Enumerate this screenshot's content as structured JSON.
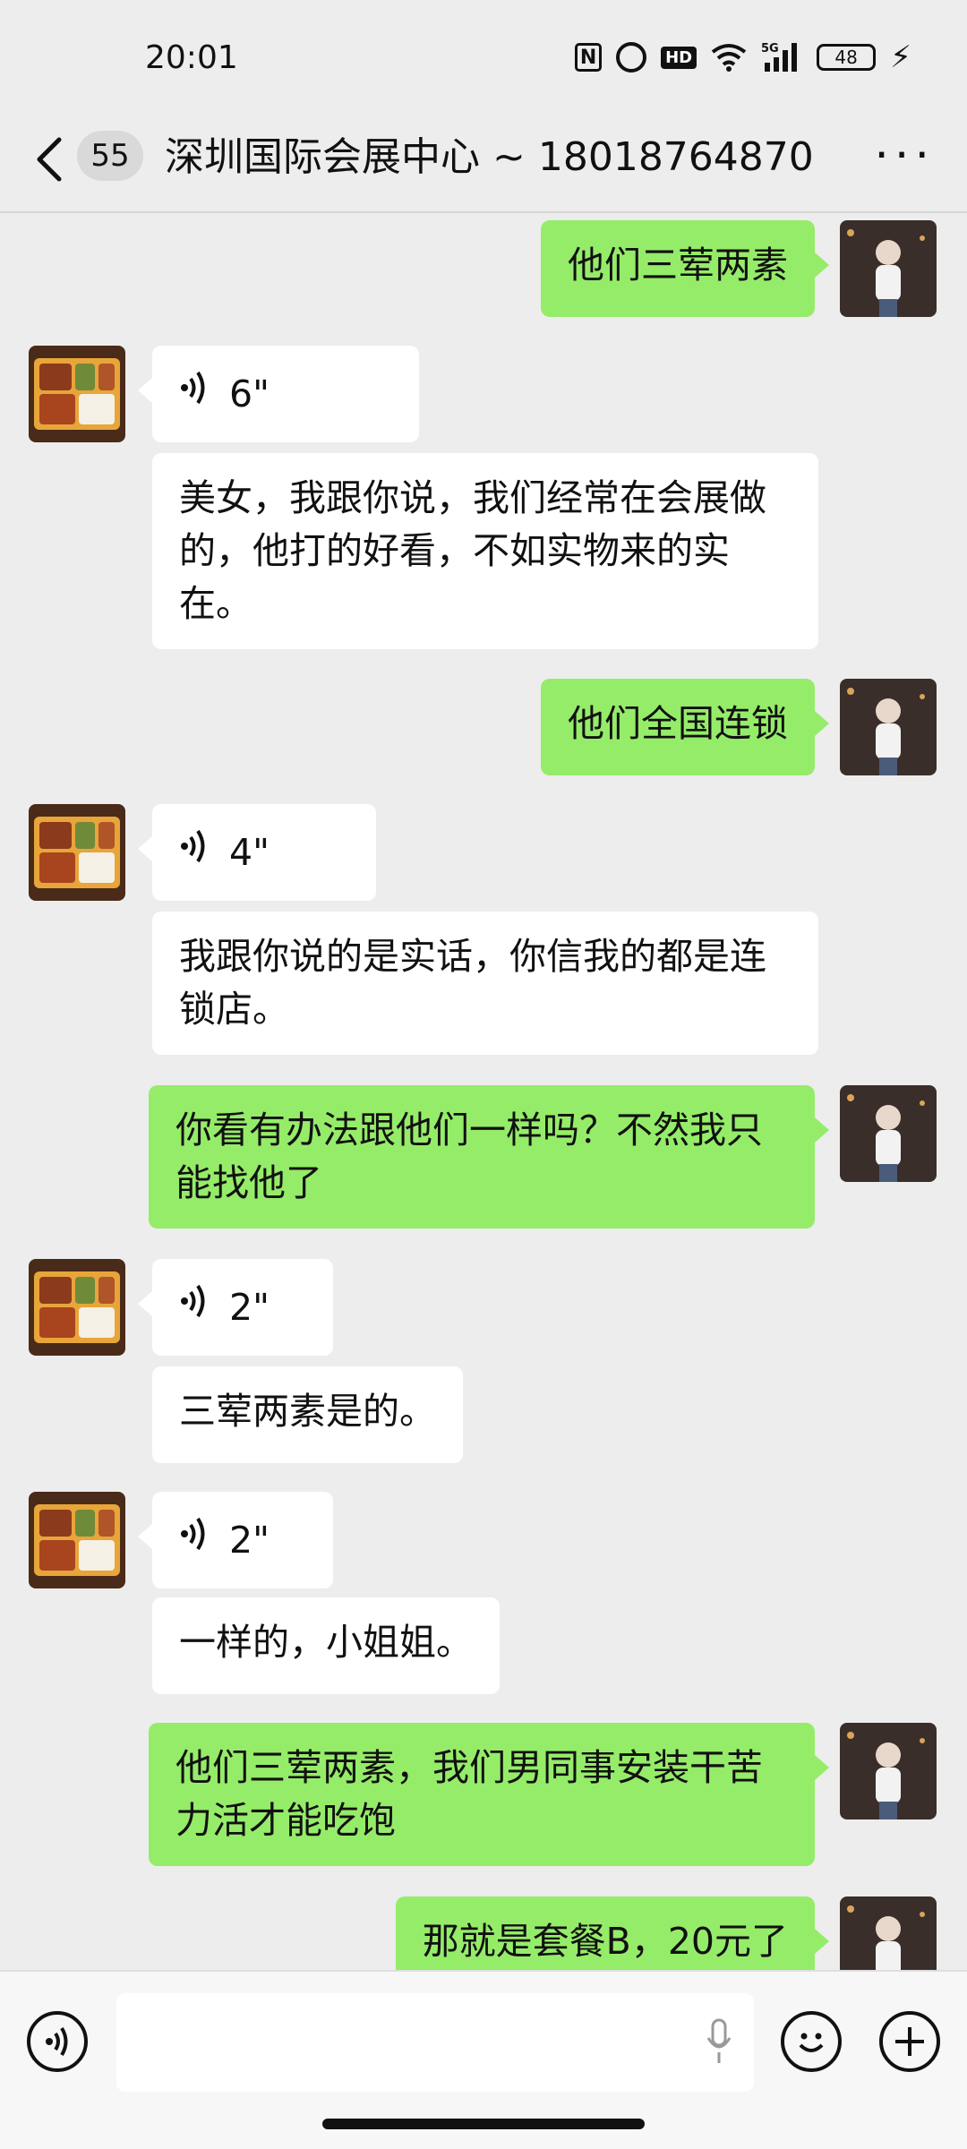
{
  "status_bar": {
    "time": "20:01",
    "icons": [
      "nfc-icon",
      "alarm-icon",
      "hd-icon",
      "wifi-icon",
      "signal-5g-icon",
      "battery-icon",
      "charging-icon"
    ],
    "hd_label": "HD",
    "network_label": "5G",
    "battery_level": "48"
  },
  "header": {
    "unread_count": "55",
    "title": "深圳国际会展中心 ~ 18018764870",
    "more_glyph": "···"
  },
  "colors": {
    "background": "#ededed",
    "outgoing_bubble": "#95ec69",
    "incoming_bubble": "#ffffff"
  },
  "messages": [
    {
      "direction": "out",
      "type": "text",
      "text": "他们三荤两素"
    },
    {
      "direction": "in",
      "type": "voice",
      "duration": "6\""
    },
    {
      "direction": "in",
      "type": "text",
      "text": "美女，我跟你说，我们经常在会展做的，他打的好看，不如实物来的实在。"
    },
    {
      "direction": "out",
      "type": "text",
      "text": "他们全国连锁"
    },
    {
      "direction": "in",
      "type": "voice",
      "duration": "4\""
    },
    {
      "direction": "in",
      "type": "text",
      "text": "我跟你说的是实话，你信我的都是连锁店。"
    },
    {
      "direction": "out",
      "type": "text",
      "text": "你看有办法跟他们一样吗？不然我只能找他了"
    },
    {
      "direction": "in",
      "type": "voice",
      "duration": "2\""
    },
    {
      "direction": "in",
      "type": "text",
      "text": "三荤两素是的。"
    },
    {
      "direction": "in",
      "type": "voice",
      "duration": "2\""
    },
    {
      "direction": "in",
      "type": "text",
      "text": "一样的，小姐姐。"
    },
    {
      "direction": "out",
      "type": "text",
      "text": "他们三荤两素，我们男同事安装干苦力活才能吃饱"
    },
    {
      "direction": "out",
      "type": "text",
      "text": "那就是套餐B，20元了"
    }
  ],
  "bottom_bar": {
    "voice_toggle_icon": "voice-input-icon",
    "input_value": "",
    "mic_icon": "microphone-icon",
    "emoji_icon": "emoji-icon",
    "plus_icon": "plus-icon"
  }
}
